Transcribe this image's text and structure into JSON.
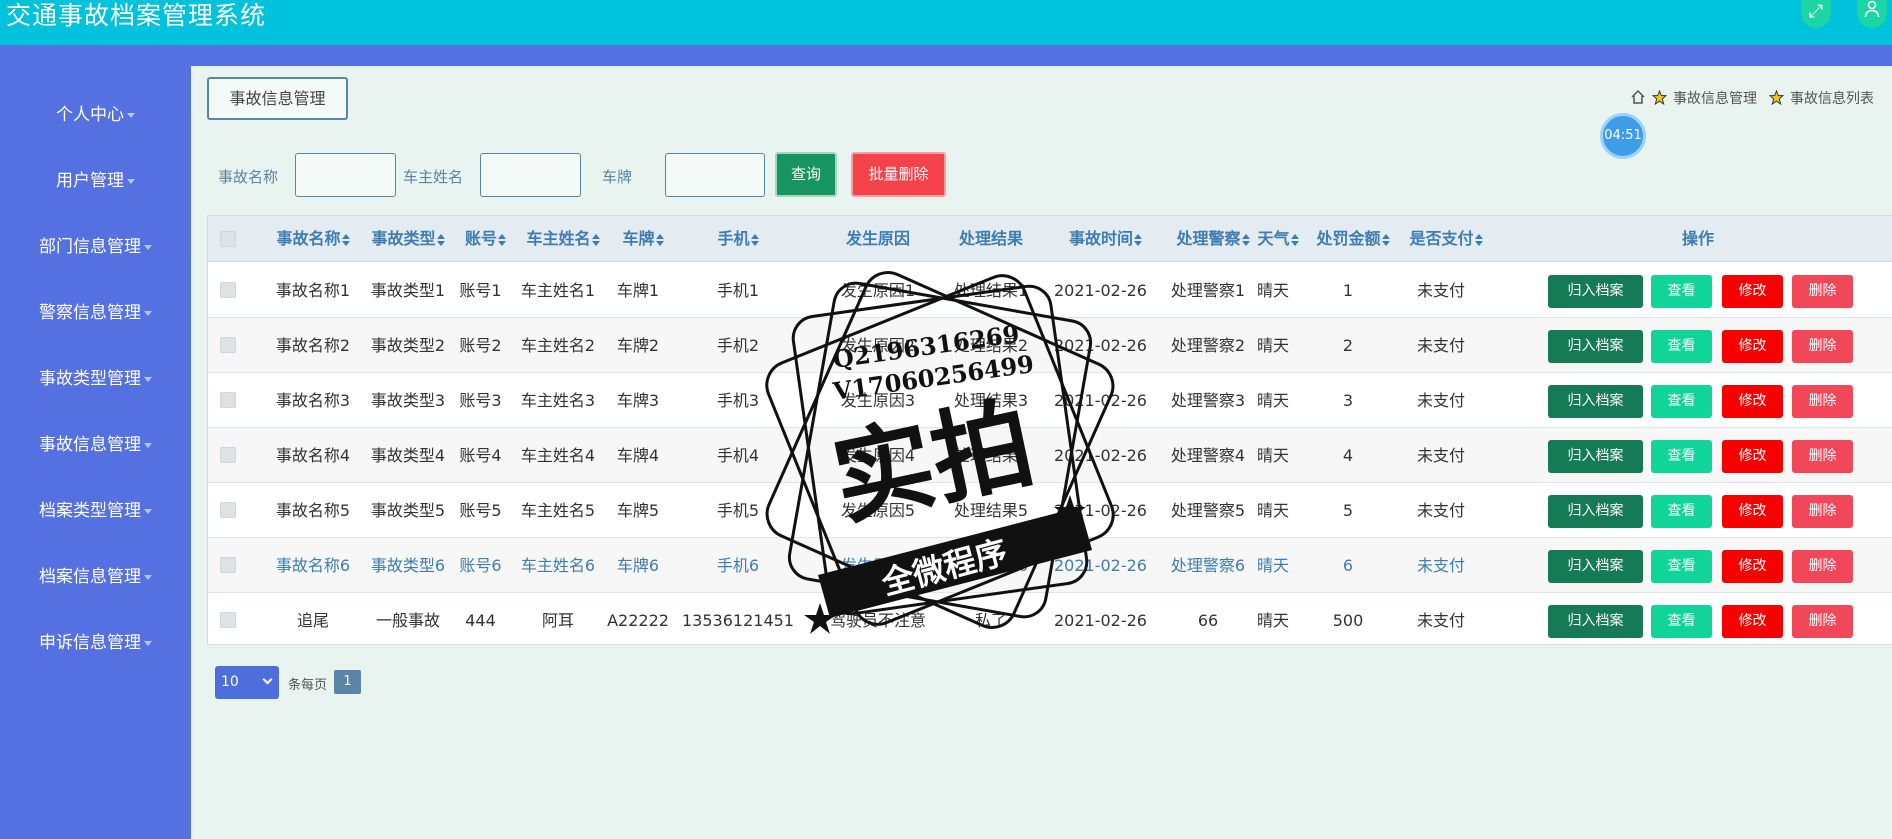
{
  "app": {
    "title": "交通事故档案管理系统",
    "fullscreen_icon": "expand-icon",
    "user_icon": "user-icon"
  },
  "sidebar": {
    "items": [
      {
        "label": "个人中心"
      },
      {
        "label": "用户管理"
      },
      {
        "label": "部门信息管理"
      },
      {
        "label": "警察信息管理"
      },
      {
        "label": "事故类型管理"
      },
      {
        "label": "事故信息管理"
      },
      {
        "label": "档案类型管理"
      },
      {
        "label": "档案信息管理"
      },
      {
        "label": "申诉信息管理"
      }
    ]
  },
  "page": {
    "title": "事故信息管理",
    "breadcrumb": [
      "事故信息管理",
      "事故信息列表"
    ],
    "clock": "04:51"
  },
  "filters": {
    "accident_name_label": "事故名称",
    "owner_name_label": "车主姓名",
    "plate_label": "车牌",
    "accident_name_value": "",
    "owner_name_value": "",
    "plate_value": "",
    "query_button": "查询",
    "bulk_delete_button": "批量删除"
  },
  "table": {
    "headers": [
      "事故名称",
      "事故类型",
      "账号",
      "车主姓名",
      "车牌",
      "手机",
      "发生原因",
      "处理结果",
      "事故时间",
      "处理警察",
      "天气",
      "处罚金额",
      "是否支付",
      "操作"
    ],
    "rows": [
      [
        "事故名称1",
        "事故类型1",
        "账号1",
        "车主姓名1",
        "车牌1",
        "手机1",
        "发生原因1",
        "处理结果1",
        "2021-02-26",
        "处理警察1",
        "晴天",
        "1",
        "未支付"
      ],
      [
        "事故名称2",
        "事故类型2",
        "账号2",
        "车主姓名2",
        "车牌2",
        "手机2",
        "发生原因2",
        "处理结果2",
        "2021-02-26",
        "处理警察2",
        "晴天",
        "2",
        "未支付"
      ],
      [
        "事故名称3",
        "事故类型3",
        "账号3",
        "车主姓名3",
        "车牌3",
        "手机3",
        "发生原因3",
        "处理结果3",
        "2021-02-26",
        "处理警察3",
        "晴天",
        "3",
        "未支付"
      ],
      [
        "事故名称4",
        "事故类型4",
        "账号4",
        "车主姓名4",
        "车牌4",
        "手机4",
        "发生原因4",
        "处理结果4",
        "2021-02-26",
        "处理警察4",
        "晴天",
        "4",
        "未支付"
      ],
      [
        "事故名称5",
        "事故类型5",
        "账号5",
        "车主姓名5",
        "车牌5",
        "手机5",
        "发生原因5",
        "处理结果5",
        "2021-02-26",
        "处理警察5",
        "晴天",
        "5",
        "未支付"
      ],
      [
        "事故名称6",
        "事故类型6",
        "账号6",
        "车主姓名6",
        "车牌6",
        "手机6",
        "发生原因6",
        "处理结果6",
        "2021-02-26",
        "处理警察6",
        "晴天",
        "6",
        "未支付"
      ],
      [
        "追尾",
        "一般事故",
        "444",
        "阿耳",
        "A22222",
        "13536121451",
        "驾驶员不注意",
        "私了",
        "2021-02-26",
        "66",
        "晴天",
        "500",
        "未支付"
      ]
    ],
    "actions": {
      "archive": "归入档案",
      "view": "查看",
      "edit": "修改",
      "delete": "删除"
    }
  },
  "pagination": {
    "page_size": "10",
    "per_page_label": "条每页",
    "current_page": "1"
  },
  "watermark": {
    "line1": "Q2196316269",
    "line2": "V17060256499",
    "main": "实拍",
    "ribbon": "全微程序"
  },
  "colors": {
    "topbar": "#00c2dc",
    "sidebar": "#5570e0",
    "header_text": "#3e7db2",
    "archive": "#157a56",
    "view": "#11d498",
    "edit": "#f60000",
    "delete": "#f24759"
  }
}
